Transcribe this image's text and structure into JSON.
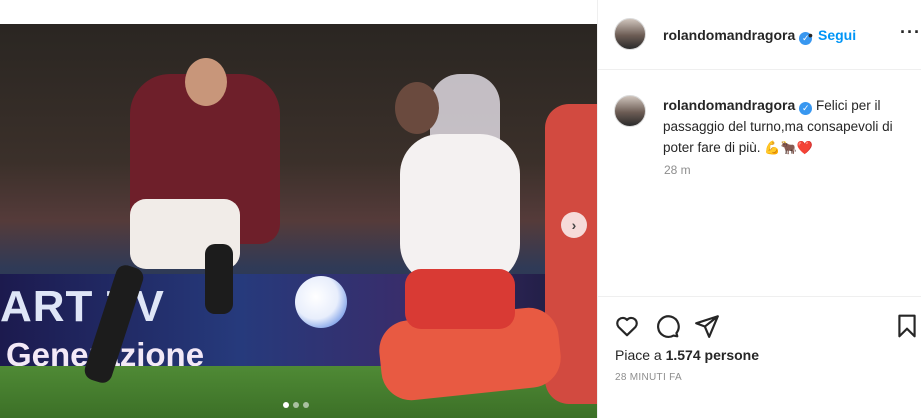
{
  "post": {
    "username": "rolandomandragora",
    "verified": true,
    "follow_label": "Segui",
    "separator": "•",
    "more_icon": "more-options-icon",
    "caption_text": "Felici per il passaggio del turno,ma consapevoli di poter fare di più.",
    "caption_emojis": "💪🐂❤️",
    "relative_time": "28 m",
    "likes_prefix": "Piace a",
    "likes_count": "1.574",
    "likes_suffix": "persone",
    "timestamp": "28 MINUTI FA",
    "carousel": {
      "slides": 3,
      "active_index": 0
    }
  },
  "media": {
    "banner_line1": "ART TV",
    "banner_line2": "Generazione"
  },
  "colors": {
    "accent": "#0095f6",
    "verified": "#3897f0",
    "muted_text": "#8e8e8e",
    "text": "#262626",
    "border": "#efefef"
  },
  "icons": {
    "like": "heart-icon",
    "comment": "comment-icon",
    "share": "paper-plane-icon",
    "save": "bookmark-icon",
    "next": "chevron-right-icon",
    "verified": "verified-badge-icon"
  }
}
